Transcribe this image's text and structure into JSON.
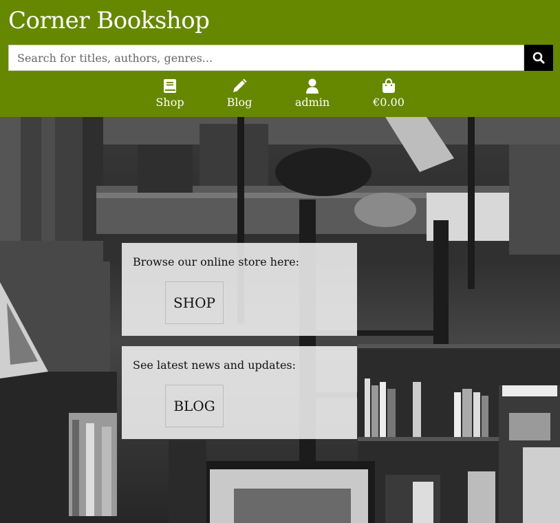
{
  "brand": {
    "title": "Corner Bookshop"
  },
  "search": {
    "placeholder": "Search for titles, authors, genres...",
    "value": ""
  },
  "nav": {
    "items": [
      {
        "label": "Shop",
        "icon": "book-icon"
      },
      {
        "label": "Blog",
        "icon": "pencil-icon"
      },
      {
        "label": "admin",
        "icon": "user-icon"
      },
      {
        "label": "€0.00",
        "icon": "shopping-bag-icon"
      }
    ]
  },
  "cards": {
    "shop": {
      "text": "Browse our online store here:",
      "button": "SHOP"
    },
    "blog": {
      "text": "See latest news and updates:",
      "button": "BLOG"
    }
  },
  "colors": {
    "header_bg": "#668800",
    "search_button_bg": "#000000"
  }
}
